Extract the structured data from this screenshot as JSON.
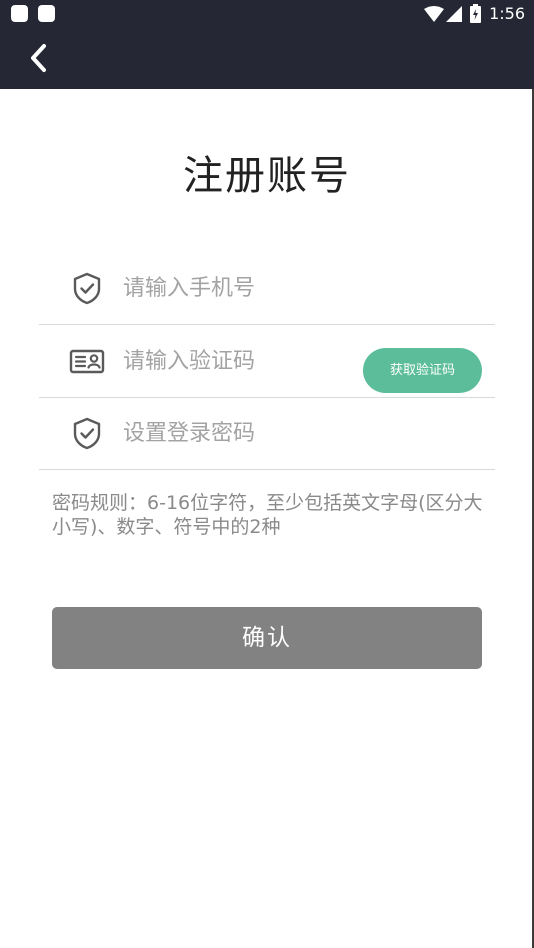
{
  "status_bar": {
    "time": "1:56",
    "icons": [
      "notification-square-icon",
      "notification-square-icon",
      "wifi-icon",
      "signal-icon",
      "battery-icon"
    ]
  },
  "app_bar": {
    "back_icon": "chevron-left-icon"
  },
  "page": {
    "title": "注册账号"
  },
  "form": {
    "phone": {
      "icon": "shield-check-icon",
      "placeholder": "请输入手机号",
      "value": ""
    },
    "code": {
      "icon": "id-card-icon",
      "placeholder": "请输入验证码",
      "value": "",
      "button_label": "获取验证码"
    },
    "password": {
      "icon": "shield-check-icon",
      "placeholder": "设置登录密码",
      "value": ""
    },
    "hint": "密码规则：6-16位字符，至少包括英文字母(区分大小写)、数字、符号中的2种",
    "confirm_label": "确认"
  },
  "colors": {
    "header_bg": "#252834",
    "accent_green": "#5cbd9b",
    "button_gray": "#828282",
    "placeholder_gray": "#a3a3a3"
  }
}
